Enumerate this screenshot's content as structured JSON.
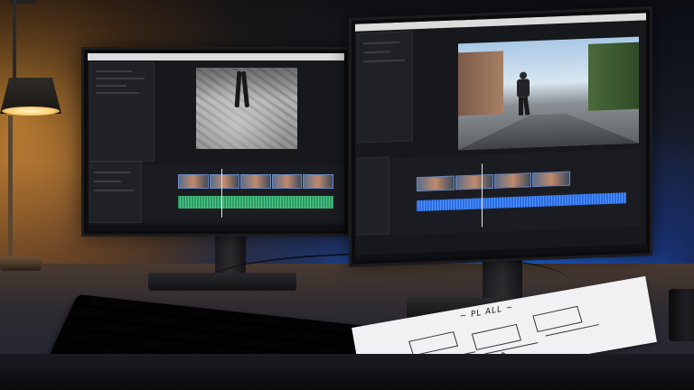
{
  "scene": {
    "description_free": true
  },
  "sketch_note": {
    "title": "~ PL ALL ~"
  },
  "colors": {
    "lamp_glow": "#ffb347",
    "backlight": "#1e6eff",
    "audio_track_left": "#3bbf7a",
    "audio_track_right": "#2d6de0"
  }
}
